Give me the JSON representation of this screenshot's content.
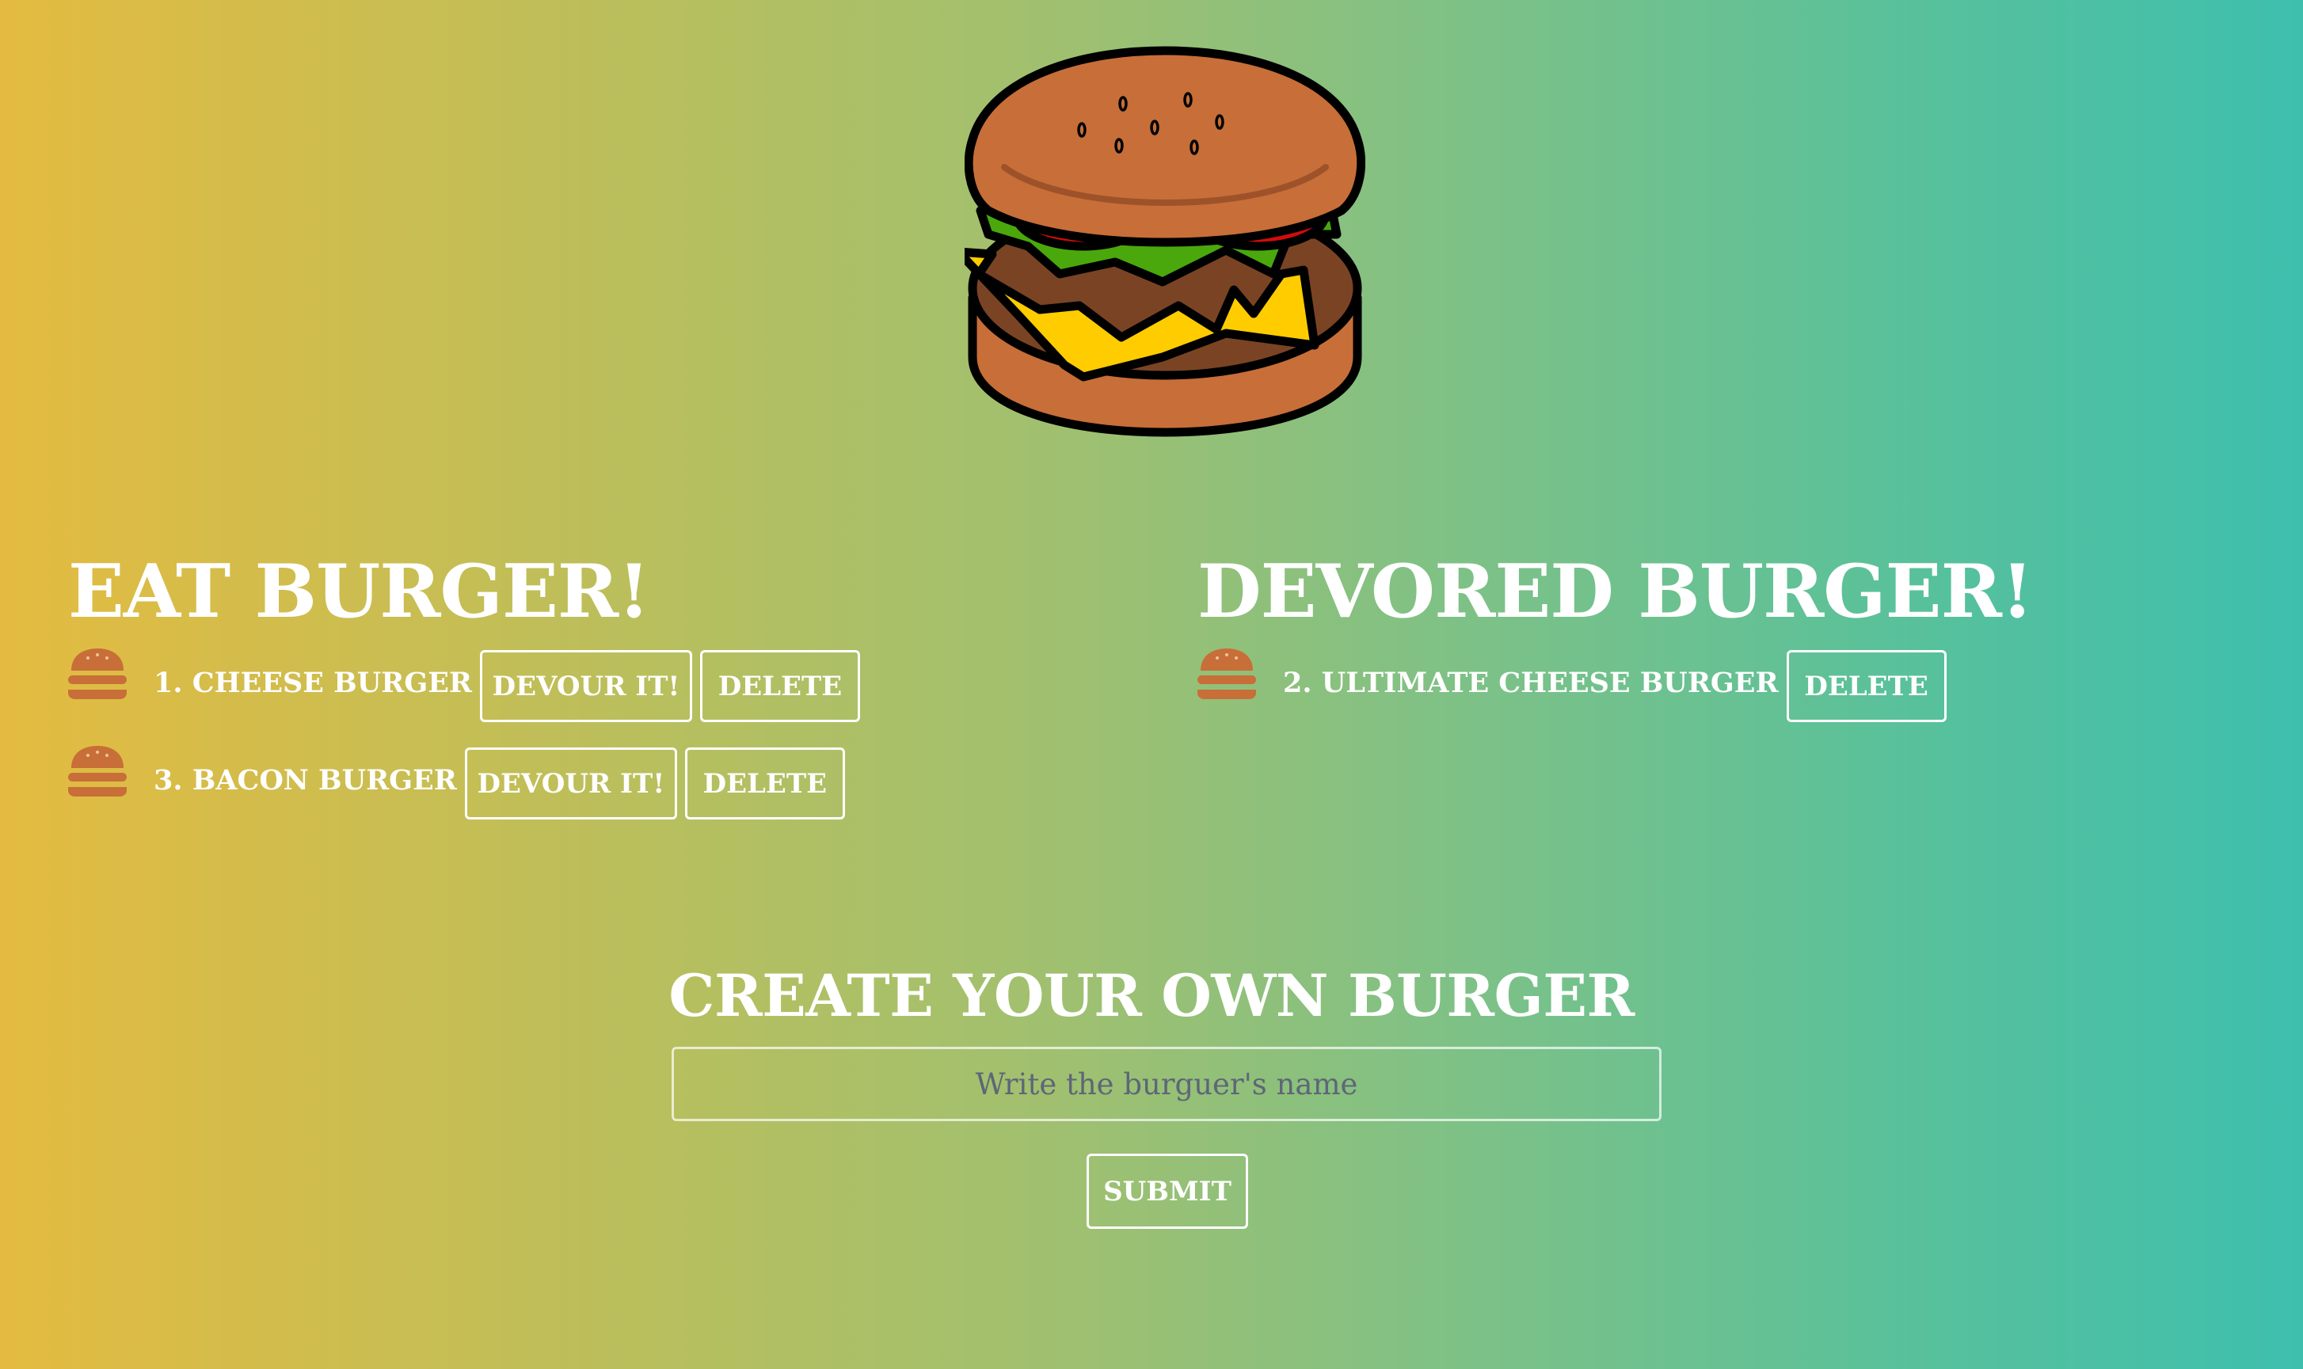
{
  "logo": {
    "icon": "burger-logo-icon"
  },
  "eat_section": {
    "title": "EAT BURGER!",
    "burgers": [
      {
        "label": "1. CHEESE BURGER",
        "devour_label": "DEVOUR IT!",
        "delete_label": "DELETE"
      },
      {
        "label": "3. BACON BURGER",
        "devour_label": "DEVOUR IT!",
        "delete_label": "DELETE"
      }
    ]
  },
  "devoured_section": {
    "title": "DEVORED BURGER!",
    "burgers": [
      {
        "label": "2. ULTIMATE CHEESE BURGER",
        "delete_label": "DELETE"
      }
    ]
  },
  "create_form": {
    "title": "CREATE YOUR OWN BURGER",
    "input_value": "",
    "input_placeholder": "Write the burguer's name",
    "submit_label": "SUBMIT"
  },
  "colors": {
    "gradient_left": "#e4bb40",
    "gradient_right": "#3ebfae",
    "text": "#ffffff",
    "bun": "#c86e38",
    "lettuce": "#4aa80c",
    "tomato": "#d40b0b",
    "cheese": "#ffcc00",
    "patty": "#7a4424"
  }
}
